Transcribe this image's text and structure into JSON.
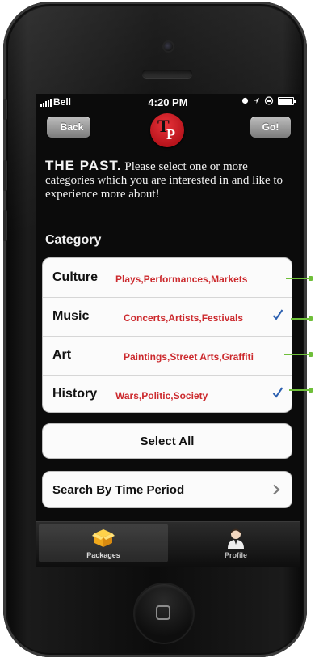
{
  "status_bar": {
    "carrier": "Bell",
    "time": "4:20 PM"
  },
  "nav": {
    "back_label": "Back",
    "go_label": "Go!",
    "logo_letters": [
      "T",
      "P"
    ]
  },
  "intro": {
    "heading": "THE PAST.",
    "text": "Please select one or more categories which you are interested in and like to experience more about!"
  },
  "section_label": "Category",
  "categories": [
    {
      "name": "Culture",
      "description": "Plays,Performances,Markets",
      "checked": false
    },
    {
      "name": "Music",
      "description": "Concerts,Artists,Festivals",
      "checked": true
    },
    {
      "name": "Art",
      "description": "Paintings,Street Arts,Graffiti",
      "checked": false
    },
    {
      "name": "History",
      "description": "Wars,Politic,Society",
      "checked": true
    }
  ],
  "select_all_label": "Select All",
  "search_time_label": "Search By Time Period",
  "tabs": [
    {
      "label": "Packages",
      "icon": "box-icon",
      "selected": true
    },
    {
      "label": "Profile",
      "icon": "person-icon",
      "selected": false
    }
  ],
  "colors": {
    "accent_red": "#cc2a2e",
    "check_blue": "#2b5fb0",
    "annotation_green": "#6fbf3a"
  }
}
